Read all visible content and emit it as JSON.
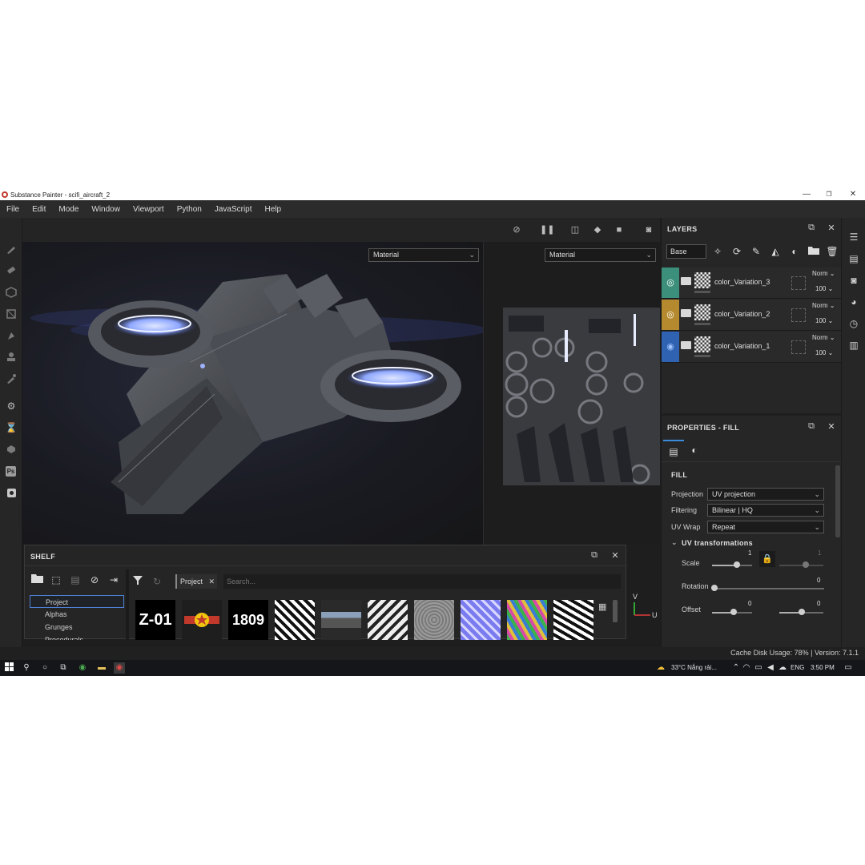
{
  "window": {
    "title": "Substance Painter - scifi_aircraft_2",
    "minimize": "—",
    "restore": "❐",
    "close": "✕"
  },
  "menu": [
    "File",
    "Edit",
    "Mode",
    "Window",
    "Viewport",
    "Python",
    "JavaScript",
    "Help"
  ],
  "left_tools": [
    "paint-brush-icon",
    "eraser-icon",
    "projection-icon",
    "geometry-mask-icon",
    "smudge-icon",
    "clone-stamp-icon",
    "color-picker-icon",
    "settings-icon",
    "bake-icon",
    "plugin-icon",
    "photoshop-icon",
    "export-icon"
  ],
  "viewport": {
    "material_left": "Material",
    "material_right": "Material",
    "toolbar_icons": [
      "hide-icon",
      "pause-icon",
      "split-view-icon",
      "cube-icon",
      "camera-icon",
      "screenshot-icon"
    ],
    "axis_y": "V",
    "axis_x": "U"
  },
  "shelf": {
    "title": "SHELF",
    "categories": [
      "Project",
      "Alphas",
      "Grunges",
      "Procedurals"
    ],
    "selected_category": "Project",
    "filter_tag": "Project",
    "search_placeholder": "Search...",
    "thumbnails": [
      {
        "type": "text",
        "label": "Z-01"
      },
      {
        "type": "emblem",
        "label": ""
      },
      {
        "type": "text",
        "label": "1809"
      },
      {
        "type": "bw-uv",
        "label": ""
      },
      {
        "type": "landscape",
        "label": ""
      },
      {
        "type": "bw-uv",
        "label": ""
      },
      {
        "type": "gray-noise",
        "label": ""
      },
      {
        "type": "normal-map",
        "label": ""
      },
      {
        "type": "color-id",
        "label": ""
      },
      {
        "type": "bw-uv",
        "label": ""
      }
    ]
  },
  "layers": {
    "title": "LAYERS",
    "channel": "Base Color",
    "items": [
      {
        "name": "color_Variation_3",
        "blend": "Norm",
        "opacity": "100",
        "color": "#3c8f7a"
      },
      {
        "name": "color_Variation_2",
        "blend": "Norm",
        "opacity": "100",
        "color": "#b58a2e"
      },
      {
        "name": "color_Variation_1",
        "blend": "Norm",
        "opacity": "100",
        "color": "#2f62b0"
      }
    ]
  },
  "properties": {
    "title": "PROPERTIES - FILL",
    "section": "FILL",
    "projection_label": "Projection",
    "projection_value": "UV projection",
    "filtering_label": "Filtering",
    "filtering_value": "Bilinear | HQ",
    "uvwrap_label": "UV Wrap",
    "uvwrap_value": "Repeat",
    "uv_transformations": "UV transformations",
    "scale_label": "Scale",
    "scale_u": "1",
    "scale_v": "1",
    "rotation_label": "Rotation",
    "rotation_value": "0",
    "offset_label": "Offset",
    "offset_u": "0",
    "offset_v": "0"
  },
  "status": {
    "text": "Cache Disk Usage: 78% | Version: 7.1.1"
  },
  "taskbar": {
    "weather": "33°C  Nắng rải...",
    "language": "ENG",
    "time": "3:50 PM"
  },
  "colors": {
    "accent": "#3a8bdc",
    "panel": "#262626",
    "glow": "#8fa8ff"
  }
}
